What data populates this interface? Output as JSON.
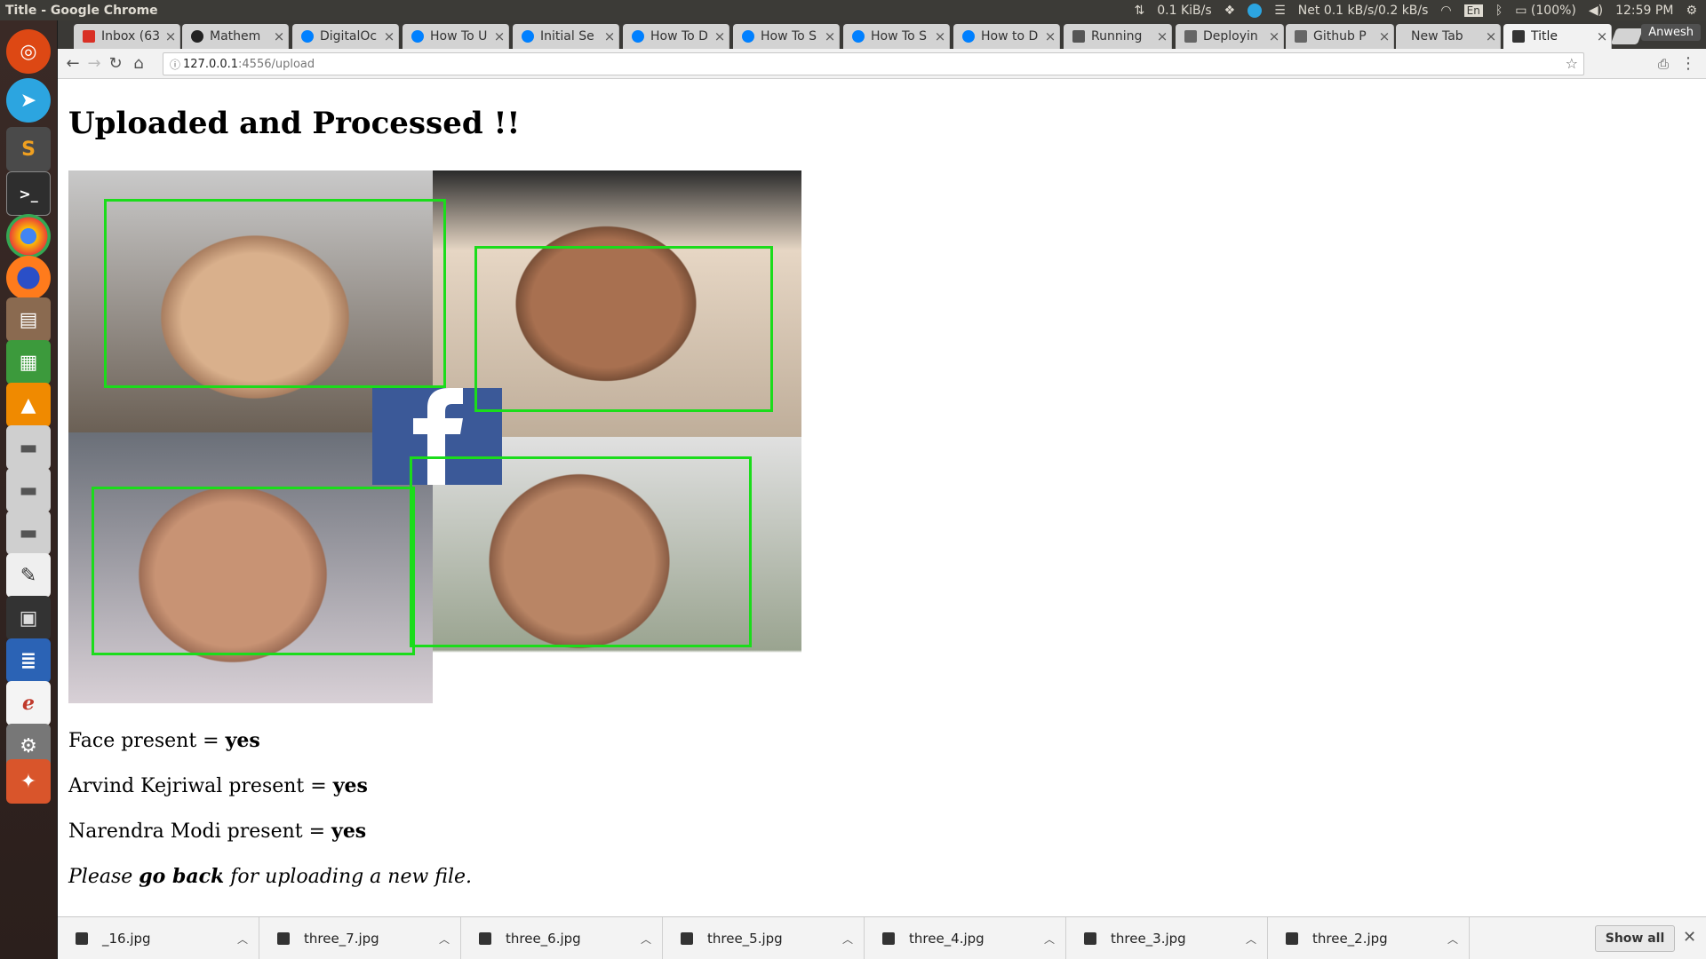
{
  "system": {
    "window_title": "Title - Google Chrome",
    "net_speed": "0.1 KiB/s",
    "net_status": "Net 0.1 kB/s/0.2 kB/s",
    "keyboard": "En",
    "battery": "(100%)",
    "clock": "12:59 PM"
  },
  "launcher": {
    "items": [
      "ubuntu-home",
      "telegram",
      "sublime-text",
      "terminal",
      "chrome",
      "firefox",
      "files",
      "spreadsheet",
      "vlc",
      "drive",
      "drive",
      "drive",
      "text-editor",
      "video-editor",
      "document-writer",
      "pdf-reader",
      "system-settings",
      "store"
    ]
  },
  "browser": {
    "profile_name": "Anwesh",
    "tabs": [
      {
        "label": "Inbox (63",
        "icon": "gmail-icon"
      },
      {
        "label": "Mathem",
        "icon": "github-icon"
      },
      {
        "label": "DigitalOc",
        "icon": "digitalocean-icon"
      },
      {
        "label": "How To U",
        "icon": "digitalocean-icon"
      },
      {
        "label": "Initial Se",
        "icon": "digitalocean-icon"
      },
      {
        "label": "How To D",
        "icon": "digitalocean-icon"
      },
      {
        "label": "How To S",
        "icon": "digitalocean-icon"
      },
      {
        "label": "How To S",
        "icon": "digitalocean-icon"
      },
      {
        "label": "How to D",
        "icon": "digitalocean-icon"
      },
      {
        "label": "Running",
        "icon": "doc-icon"
      },
      {
        "label": "Deployin",
        "icon": "page-icon"
      },
      {
        "label": "Github P",
        "icon": "page-icon"
      },
      {
        "label": "New Tab",
        "icon": "none"
      },
      {
        "label": "Title",
        "icon": "terminal-icon"
      }
    ],
    "url": {
      "host": "127.0.0.1",
      "rest": ":4556/upload"
    }
  },
  "page": {
    "heading": "Uploaded and Processed !!",
    "results": [
      {
        "label": "Face present = ",
        "value": "yes"
      },
      {
        "label": "Arvind Kejriwal present = ",
        "value": "yes"
      },
      {
        "label": "Narendra Modi present = ",
        "value": "yes"
      }
    ],
    "footer_prefix": "Please ",
    "footer_link": "go back",
    "footer_suffix": " for uploading a new file."
  },
  "downloads": {
    "items": [
      "_16.jpg",
      "three_7.jpg",
      "three_6.jpg",
      "three_5.jpg",
      "three_4.jpg",
      "three_3.jpg",
      "three_2.jpg"
    ],
    "show_all": "Show all"
  },
  "colors": {
    "face_box": "#1bdc1b",
    "facebook_blue": "#3b5998"
  }
}
